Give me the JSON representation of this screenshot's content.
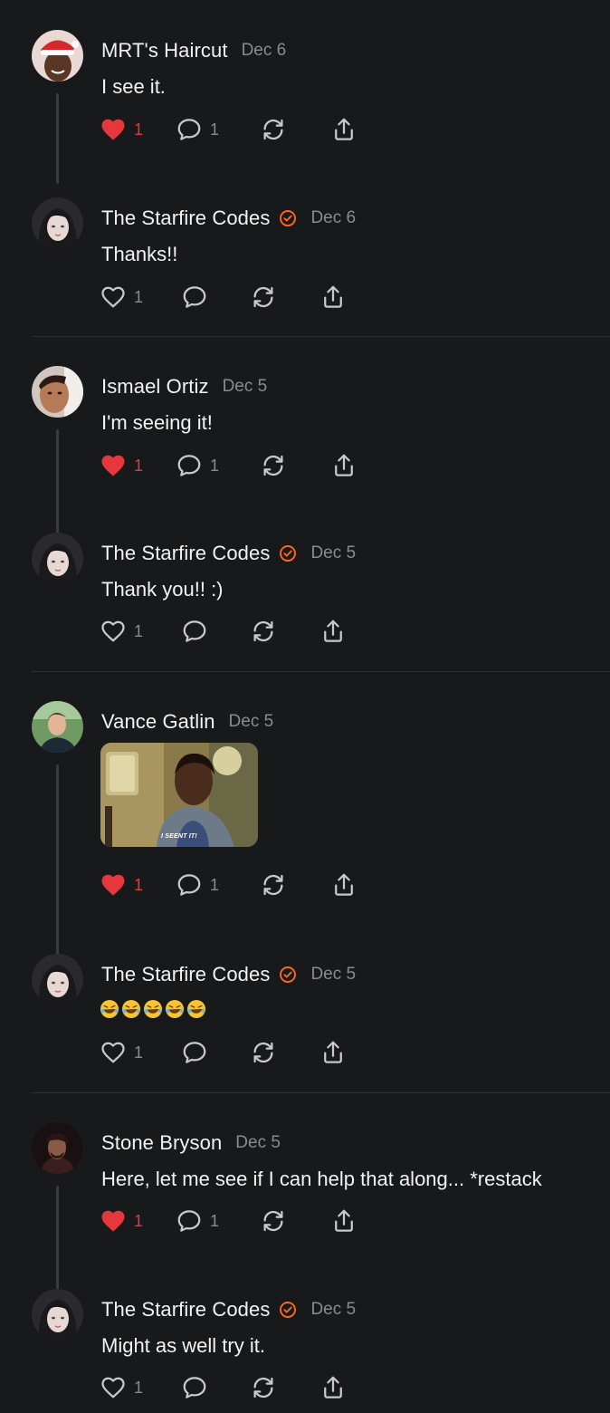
{
  "colors": {
    "background": "#18191b",
    "like_active": "#e6373c",
    "verified_badge": "#ff6719",
    "muted": "#8a8b8e"
  },
  "threads": [
    {
      "parent": {
        "author": "MRT's Haircut",
        "date": "Dec 6",
        "text": "I see it.",
        "likes": "1",
        "liked": true,
        "replies": "1"
      },
      "reply": {
        "author": "The Starfire Codes",
        "verified": true,
        "date": "Dec 6",
        "text": "Thanks!!",
        "likes": "1"
      }
    },
    {
      "parent": {
        "author": "Ismael Ortiz",
        "date": "Dec 5",
        "text": "I'm seeing it!",
        "likes": "1",
        "liked": true,
        "replies": "1"
      },
      "reply": {
        "author": "The Starfire Codes",
        "verified": true,
        "date": "Dec 5",
        "text": "Thank you!! :)",
        "likes": "1"
      }
    },
    {
      "parent": {
        "author": "Vance Gatlin",
        "date": "Dec 5",
        "gif_caption": "I SEENT IT!",
        "likes": "1",
        "liked": true,
        "replies": "1"
      },
      "reply": {
        "author": "The Starfire Codes",
        "verified": true,
        "date": "Dec 5",
        "emoji": "rolling-on-floor-laughing x5",
        "likes": "1"
      }
    },
    {
      "parent": {
        "author": "Stone Bryson",
        "date": "Dec 5",
        "text": "Here, let me see if I can help that along... *restack",
        "likes": "1",
        "liked": true,
        "replies": "1"
      },
      "reply": {
        "author": "The Starfire Codes",
        "verified": true,
        "date": "Dec 5",
        "text": "Might as well try it.",
        "likes": "1"
      }
    }
  ]
}
